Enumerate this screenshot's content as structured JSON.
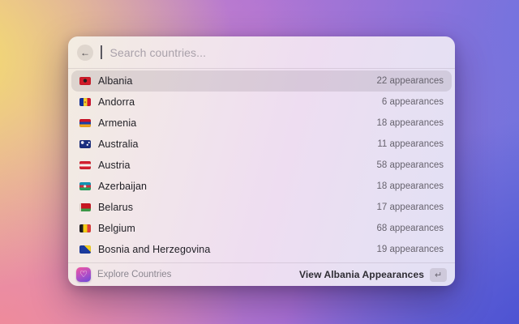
{
  "search": {
    "placeholder": "Search countries...",
    "back_icon": "←"
  },
  "list": {
    "items": [
      {
        "name": "Albania",
        "count": "22 appearances",
        "selected": true,
        "flag_style": "background:radial-gradient(circle at 50% 46%, #231f20 0 2px, rgba(0,0,0,0) 2.4px) #d01c2a"
      },
      {
        "name": "Andorra",
        "count": "6 appearances",
        "selected": false,
        "flag_style": "background:radial-gradient(circle at 50% 52%, #b86b2a 0 1px, rgba(0,0,0,0) 1.3px), linear-gradient(90deg, #10309c 0 34%, #f4d332 34% 67%, #d0122e 67%)"
      },
      {
        "name": "Armenia",
        "count": "18 appearances",
        "selected": false,
        "flag_style": "background:linear-gradient(180deg, #d01226 0 33%, #1a41a8 33% 67%, #f2a41b 67%)"
      },
      {
        "name": "Australia",
        "count": "11 appearances",
        "selected": false,
        "flag_style": "background:radial-gradient(circle at 26% 30%, #e9e9f2 0 1.7px, rgba(0,0,0,0) 2.1px), radial-gradient(circle at 70% 58%, #ffffff 0 0.9px, rgba(0,0,0,0) 1.3px), radial-gradient(circle at 84% 30%, #ffffff 0 0.8px, rgba(0,0,0,0) 1.2px) #1b2f80"
      },
      {
        "name": "Austria",
        "count": "58 appearances",
        "selected": false,
        "flag_style": "background:linear-gradient(180deg, #d42030 0 33%, #f5f1ee 33% 67%, #d42030 67%)"
      },
      {
        "name": "Azerbaijan",
        "count": "18 appearances",
        "selected": false,
        "flag_style": "background:radial-gradient(circle at 48% 50%, #f2efe8 0 1.4px, rgba(0,0,0,0) 1.8px), linear-gradient(180deg, #0f95b5 0 33%, #d22d3e 33% 67%, #27a15e 67%)"
      },
      {
        "name": "Belarus",
        "count": "17 appearances",
        "selected": false,
        "flag_style": "background:linear-gradient(90deg, #e9dcd6 0 13%, rgba(0,0,0,0) 13%), linear-gradient(180deg, #c81622 0 66%, #3d9c48 66%)"
      },
      {
        "name": "Belgium",
        "count": "68 appearances",
        "selected": false,
        "flag_style": "background:linear-gradient(90deg, #1d1d1f 0 33%, #f3ce17 33% 67%, #e23c39 67%)"
      },
      {
        "name": "Bosnia and Herzegovina",
        "count": "19 appearances",
        "selected": false,
        "flag_style": "background:linear-gradient(225deg, #f5cf1f 0 34%, rgba(0,0,0,0) 34.5%) #1c3b9e"
      }
    ]
  },
  "footer": {
    "app_name": "Explore Countries",
    "heart_icon": "♡",
    "action_label": "View Albania Appearances",
    "return_key_icon": "↵"
  },
  "colors": {
    "selection_highlight": "rgba(104,92,104,0.16)",
    "window_tint_left": "#f3ece1",
    "window_tint_right": "#e2e0f4"
  }
}
